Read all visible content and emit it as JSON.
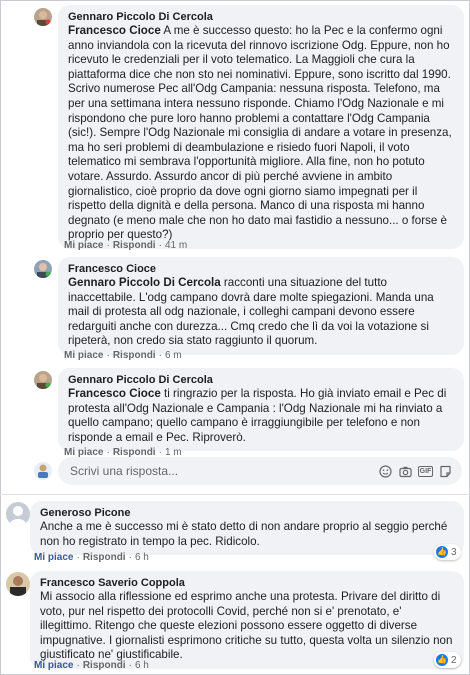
{
  "comments": [
    {
      "author": "Gennaro Piccolo Di Cercola",
      "mention": "Francesco Cioce",
      "text": " A me è successo questo: ho la Pec e la confermo ogni anno inviandola con la ricevuta del rinnovo iscrizione Odg. Eppure, non ho ricevuto le credenziali per il voto telematico. La Maggioli che cura la piattaforma dice che non sto nei nominativi. Eppure, sono iscritto dal 1990. Scrivo numerose Pec all'Odg Campania: nessuna risposta. Telefono, ma per una settimana intera nessuno risponde. Chiamo l'Odg Nazionale e mi rispondono che pure loro hanno problemi a contattare l'Odg Campania (sic!). Sempre l'Odg Nazionale mi consiglia di andare a votare in presenza, ma ho seri problemi di deambulazione e risiedo fuori Napoli, il voto telematico mi sembrava l'opportunità migliore. Alla fine, non ho potuto votare. Assurdo. Assurdo ancor di più perché avviene in ambito giornalistico, cioè proprio da dove ogni giorno siamo impegnati per il rispetto della dignità e della persona. Manco di una risposta mi hanno degnato (e meno male che non ho dato mai fastidio a nessuno... o forse è proprio per questo?)",
      "like": "Mi piace",
      "reply": "Rispondi",
      "time": "41 m"
    },
    {
      "author": "Francesco Cioce",
      "mention": "Gennaro Piccolo Di Cercola",
      "text": " racconti una situazione del tutto inaccettabile. L'odg campano dovrà dare molte spiegazioni. Manda una mail di protesta all odg nazionale, i colleghi campani devono essere redarguiti anche con durezza... Cmq credo che lì da voi la votazione si ripeterà, non credo sia stato raggiunto il quorum.",
      "like": "Mi piace",
      "reply": "Rispondi",
      "time": "6 m"
    },
    {
      "author": "Gennaro Piccolo Di Cercola",
      "mention": "Francesco Cioce",
      "text": " ti ringrazio per la risposta. Ho già inviato email e Pec di protesta all'Odg Nazionale e Campania : l'Odg Nazionale mi ha rinviato a quello campano; quello campano è irraggiungibile per telefono e non risponde a email e Pec. Riproverò.",
      "like": "Mi piace",
      "reply": "Rispondi",
      "time": "1 m"
    },
    {
      "author": "Generoso Picone",
      "text": "Anche a me è successo mi è stato detto di non andare proprio al seggio perché non ho registrato in tempo la pec. Ridicolo.",
      "like": "Mi piace",
      "reply": "Rispondi",
      "time": "6 h",
      "reactions": "3"
    },
    {
      "author": "Francesco Saverio Coppola",
      "text": "Mi associo alla riflessione ed esprimo anche una protesta. Privare del diritto di voto, pur nel rispetto dei protocolli Covid, perché non si e' prenotato, e' illegittimo. Ritengo che queste elezioni possono essere oggetto di diverse impugnative. I giornalisti esprimono critiche su tutto, questa volta un silenzio non giustificato ne' giustificabile.",
      "like": "Mi piace",
      "reply": "Rispondi",
      "time": "6 h",
      "reactions": "2"
    }
  ],
  "reply_box": {
    "placeholder": "Scrivi una risposta..."
  },
  "icons": {
    "avatar_gennaro": "person-photo",
    "avatar_cioce": "person-photo",
    "avatar_picone": "default-silhouette",
    "avatar_coppola": "person-photo",
    "reply_tools": [
      "emoji-icon",
      "camera-icon",
      "gif-icon",
      "sticker-icon"
    ],
    "reaction": "like-icon"
  },
  "colors": {
    "bubble": "#f0f2f5",
    "meta": "#65676b",
    "like_active": "#385898",
    "like_badge": "#1877f2"
  }
}
